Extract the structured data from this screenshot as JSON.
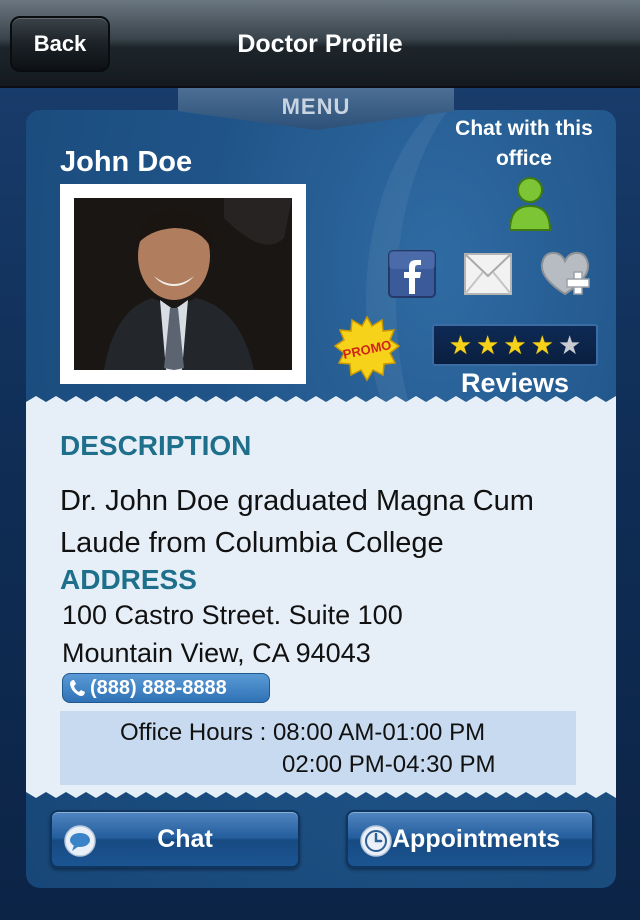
{
  "navbar": {
    "back_label": "Back",
    "title": "Doctor Profile"
  },
  "menu_tab": {
    "label": "MENU"
  },
  "profile": {
    "name": "John Doe",
    "chat_with_office": "Chat with this office",
    "rating": {
      "value": 4,
      "max": 5
    },
    "reviews_label": "Reviews",
    "promo_label": "PROMO"
  },
  "description": {
    "heading": "DESCRIPTION",
    "text": "Dr. John Doe graduated Magna Cum Laude from Columbia College"
  },
  "address": {
    "heading": "ADDRESS",
    "line1": "100 Castro Street. Suite 100",
    "line2": "Mountain View, CA 94043",
    "phone": "(888) 888-8888"
  },
  "office_hours": {
    "line1": "Office Hours : 08:00 AM-01:00 PM",
    "line2": "02:00 PM-04:30 PM"
  },
  "buttons": {
    "chat_label": "Chat",
    "appointments_label": "Appointments"
  },
  "colors": {
    "heading": "#1e6f8c",
    "background": "#174677",
    "info_panel": "#e6eef7",
    "star_on": "#f6d11a",
    "person_icon": "#7cc534"
  }
}
